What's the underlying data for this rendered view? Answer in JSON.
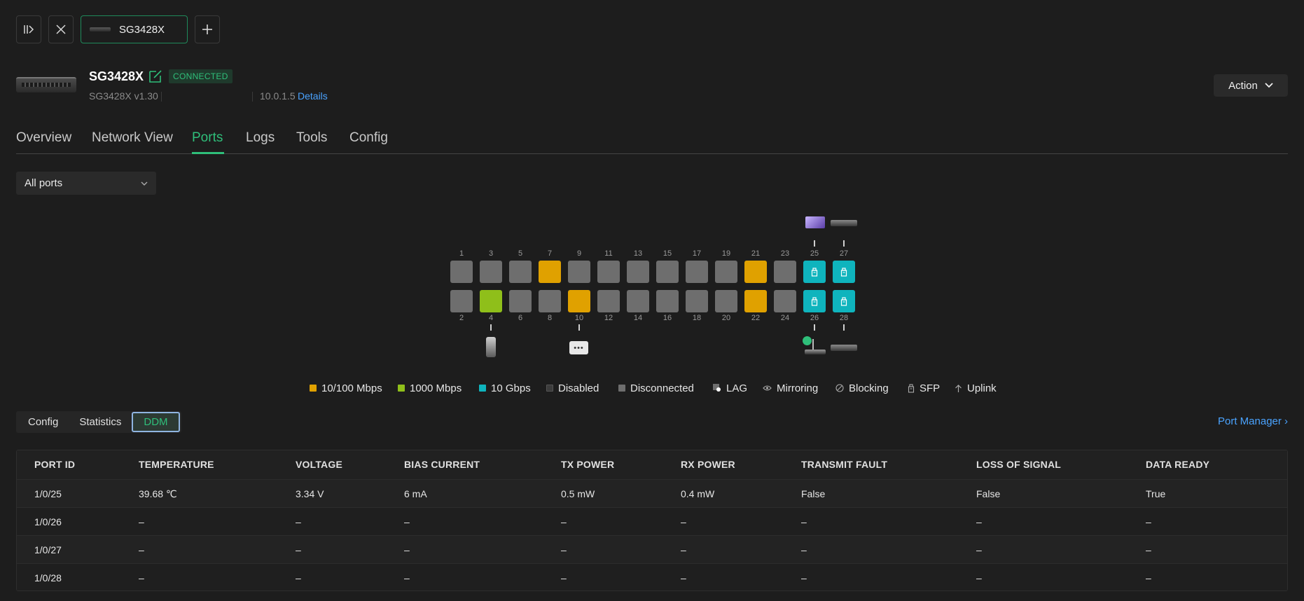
{
  "toolbar": {
    "tab_label": "SG3428X",
    "icons": [
      "collapse-sidebar-icon",
      "close-icon",
      "plus-icon"
    ]
  },
  "device": {
    "name": "SG3428X",
    "status": "CONNECTED",
    "model": "SG3428X v1.30",
    "ip": "10.0.1.5",
    "details_label": "Details",
    "action_label": "Action"
  },
  "tabs": [
    {
      "label": "Overview"
    },
    {
      "label": "Network View"
    },
    {
      "label": "Ports"
    },
    {
      "label": "Logs"
    },
    {
      "label": "Tools"
    },
    {
      "label": "Config"
    }
  ],
  "active_tab": "Ports",
  "filter": {
    "selected": "All ports"
  },
  "ports": {
    "top_numbers": [
      "1",
      "3",
      "5",
      "7",
      "9",
      "11",
      "13",
      "15",
      "17",
      "19",
      "21",
      "23",
      "25",
      "27"
    ],
    "bottom_numbers": [
      "2",
      "4",
      "6",
      "8",
      "10",
      "12",
      "14",
      "16",
      "18",
      "20",
      "22",
      "24",
      "26",
      "28"
    ],
    "top_status": [
      "disconnected",
      "disconnected",
      "disconnected",
      "10/100",
      "disconnected",
      "disconnected",
      "disconnected",
      "disconnected",
      "disconnected",
      "disconnected",
      "10/100",
      "disconnected",
      "10G-sfp",
      "10G-sfp"
    ],
    "bottom_status": [
      "disconnected",
      "1000",
      "disconnected",
      "disconnected",
      "10/100",
      "disconnected",
      "disconnected",
      "disconnected",
      "disconnected",
      "disconnected",
      "10/100",
      "disconnected",
      "10G-sfp",
      "10G-sfp"
    ],
    "colors": {
      "10/100": "#e0a100",
      "1000": "#8fbf1a",
      "10G": "#0fb4bd",
      "disconnected": "#6e6e6e",
      "disabled": "#3c3c3c"
    }
  },
  "legend": [
    {
      "label": "10/100 Mbps",
      "icon": "swatch-orange"
    },
    {
      "label": "1000 Mbps",
      "icon": "swatch-green"
    },
    {
      "label": "10 Gbps",
      "icon": "swatch-cyan"
    },
    {
      "label": "Disabled",
      "icon": "swatch-disabled"
    },
    {
      "label": "Disconnected",
      "icon": "swatch-gray"
    },
    {
      "label": "LAG",
      "icon": "lag-icon"
    },
    {
      "label": "Mirroring",
      "icon": "eye-icon"
    },
    {
      "label": "Blocking",
      "icon": "blocked-icon"
    },
    {
      "label": "SFP",
      "icon": "sfp-icon"
    },
    {
      "label": "Uplink",
      "icon": "arrow-up-icon"
    }
  ],
  "subtabs": [
    {
      "label": "Config"
    },
    {
      "label": "Statistics"
    },
    {
      "label": "DDM"
    }
  ],
  "active_subtab": "DDM",
  "port_manager_label": "Port Manager ›",
  "table": {
    "columns": [
      "PORT ID",
      "TEMPERATURE",
      "VOLTAGE",
      "BIAS CURRENT",
      "TX POWER",
      "RX POWER",
      "TRANSMIT FAULT",
      "LOSS OF SIGNAL",
      "DATA READY"
    ],
    "rows": [
      [
        "1/0/25",
        "39.68 ℃",
        "3.34 V",
        "6 mA",
        "0.5 mW",
        "0.4 mW",
        "False",
        "False",
        "True"
      ],
      [
        "1/0/26",
        "–",
        "–",
        "–",
        "–",
        "–",
        "–",
        "–",
        "–"
      ],
      [
        "1/0/27",
        "–",
        "–",
        "–",
        "–",
        "–",
        "–",
        "–",
        "–"
      ],
      [
        "1/0/28",
        "–",
        "–",
        "–",
        "–",
        "–",
        "–",
        "–",
        "–"
      ]
    ]
  }
}
